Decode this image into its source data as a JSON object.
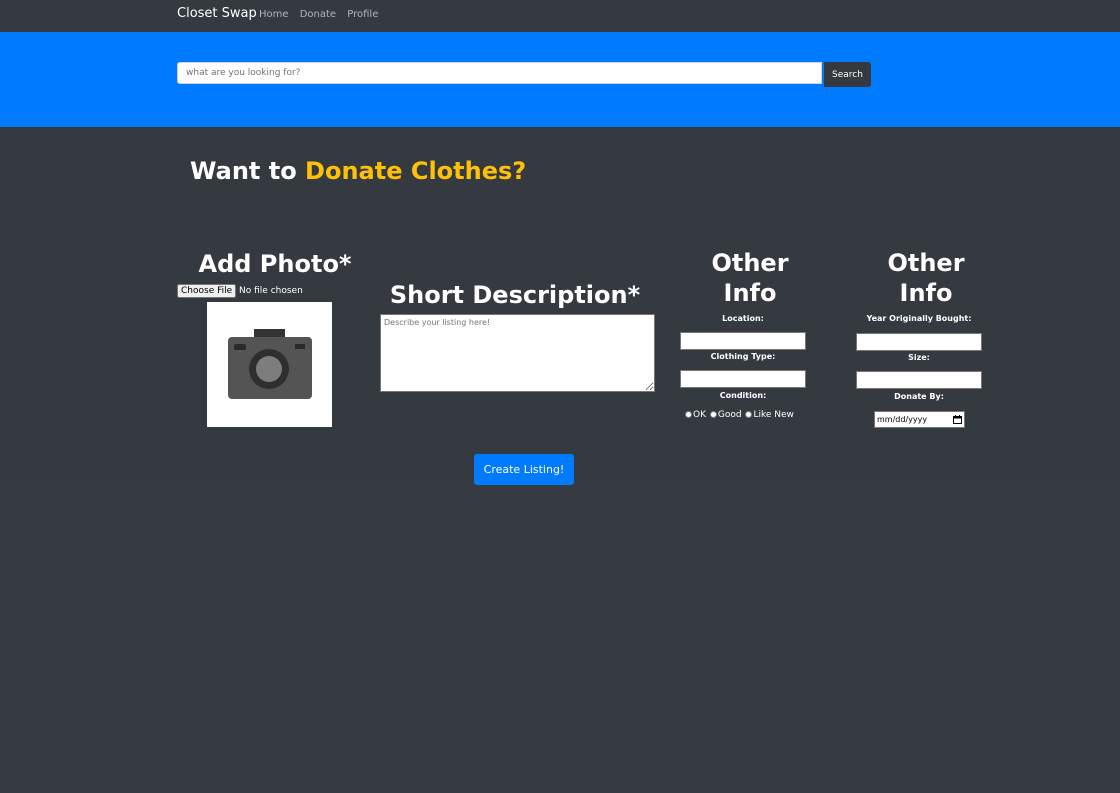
{
  "nav": {
    "brand": "Closet Swap",
    "links": [
      "Home",
      "Donate",
      "Profile"
    ]
  },
  "search": {
    "placeholder": "what are you looking for?",
    "button_label": "Search"
  },
  "headline": {
    "prefix": "Want to ",
    "accent": "Donate Clothes?"
  },
  "photo": {
    "title": "Add Photo*",
    "choose_label": "Choose File",
    "file_status": "No file chosen"
  },
  "description": {
    "title": "Short Description*",
    "placeholder": "Describe your listing here!"
  },
  "info1": {
    "title_line1": "Other",
    "title_line2": "Info",
    "location_label": "Location:",
    "clothing_label": "Clothing Type:",
    "condition_label": "Condition:",
    "conditions": [
      "OK",
      "Good",
      "Like New"
    ]
  },
  "info2": {
    "title_line1": "Other",
    "title_line2": "Info",
    "year_label": "Year Originally Bought:",
    "size_label": "Size:",
    "donate_by_label": "Donate By:",
    "date_placeholder": "mm/dd/yyyy"
  },
  "create_label": "Create Listing!",
  "colors": {
    "primary": "#007bff",
    "accent": "#ffc107",
    "dark": "#343a40",
    "background": "#363b42"
  },
  "icons": {
    "photo_placeholder": "camera-icon",
    "date_picker": "calendar-icon"
  }
}
